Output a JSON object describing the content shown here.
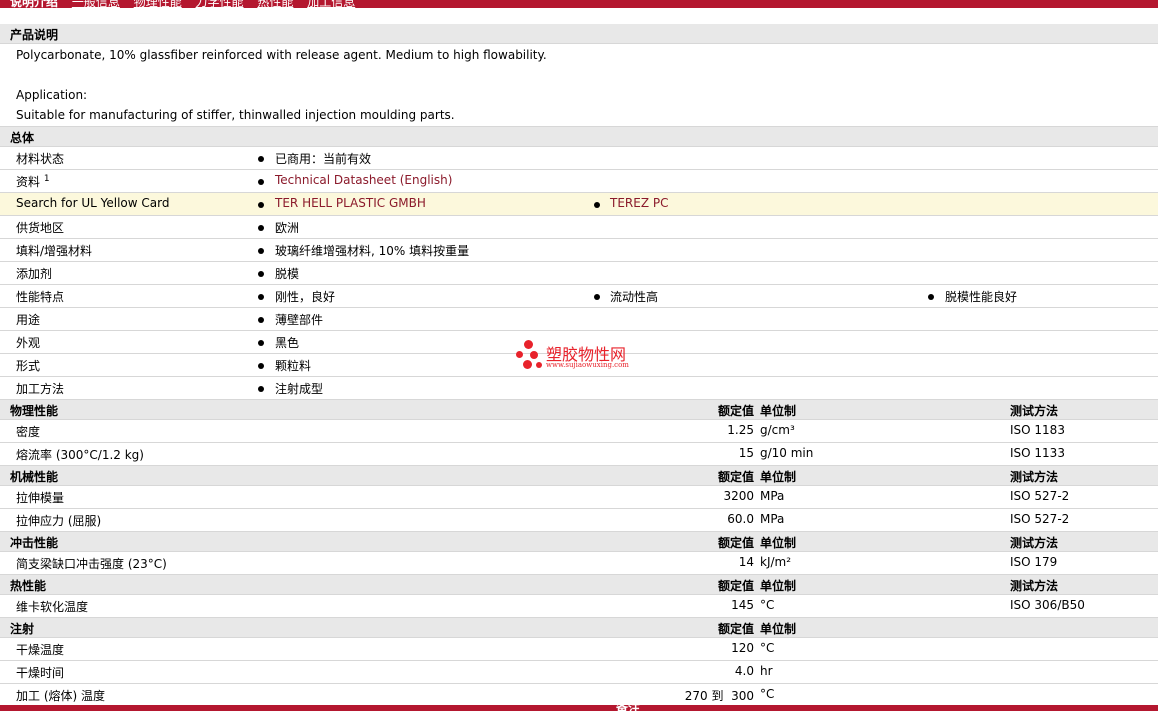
{
  "topbar": {
    "tabs": [
      "说明介绍",
      "一般信息",
      "物理性能",
      "力学性能",
      "热性能",
      "加工信息"
    ]
  },
  "description": {
    "title": "产品说明",
    "line1": "Polycarbonate, 10% glassfiber reinforced with release agent. Medium to high flowability.",
    "line2": "Application:",
    "line3": "Suitable for manufacturing of stiffer, thinwalled injection moulding parts."
  },
  "general": {
    "title": "总体",
    "rows": [
      {
        "label": "材料状态",
        "values": [
          "已商用：当前有效"
        ]
      },
      {
        "label": "资料",
        "sup": "1",
        "values": [
          "Technical Datasheet (English)"
        ]
      },
      {
        "label": "Search for UL Yellow Card",
        "values": [
          "TER HELL PLASTIC GMBH",
          "TEREZ PC"
        ]
      },
      {
        "label": "供货地区",
        "values": [
          "欧洲"
        ]
      },
      {
        "label": "填料/增强材料",
        "values": [
          "玻璃纤维增强材料, 10% 填料按重量"
        ]
      },
      {
        "label": "添加剂",
        "values": [
          "脱模"
        ]
      },
      {
        "label": "性能特点",
        "values": [
          "刚性，良好",
          "流动性高",
          "脱模性能良好"
        ]
      },
      {
        "label": "用途",
        "values": [
          "薄壁部件"
        ]
      },
      {
        "label": "外观",
        "values": [
          "黑色"
        ]
      },
      {
        "label": "形式",
        "values": [
          "颗粒料"
        ]
      },
      {
        "label": "加工方法",
        "values": [
          "注射成型"
        ]
      }
    ]
  },
  "headers": {
    "value": "额定值",
    "unit": "单位制",
    "method": "测试方法"
  },
  "physical": {
    "title": "物理性能",
    "rows": [
      {
        "label": "密度",
        "value": "1.25",
        "unit": "g/cm³",
        "method": "ISO 1183"
      },
      {
        "label": "熔流率 (300°C/1.2 kg)",
        "value": "15",
        "unit": "g/10 min",
        "method": "ISO 1133"
      }
    ]
  },
  "mechanical": {
    "title": "机械性能",
    "rows": [
      {
        "label": "拉伸模量",
        "value": "3200",
        "unit": "MPa",
        "method": "ISO 527-2"
      },
      {
        "label": "拉伸应力 (屈服)",
        "value": "60.0",
        "unit": "MPa",
        "method": "ISO 527-2"
      }
    ]
  },
  "impact": {
    "title": "冲击性能",
    "rows": [
      {
        "label": "简支梁缺口冲击强度 (23°C)",
        "value": "14",
        "unit": "kJ/m²",
        "method": "ISO 179"
      }
    ]
  },
  "thermal": {
    "title": "热性能",
    "rows": [
      {
        "label": "维卡软化温度",
        "value": "145",
        "unit": "°C",
        "method": "ISO 306/B50"
      }
    ]
  },
  "injection": {
    "title": "注射",
    "rows": [
      {
        "label": "干燥温度",
        "value": "120",
        "unit": "°C"
      },
      {
        "label": "干燥时间",
        "value": "4.0",
        "unit": "hr"
      },
      {
        "label": "加工 (熔体) 温度",
        "value": "270 到  300",
        "unit": "°C"
      }
    ]
  },
  "watermark": {
    "cn": "塑胶物性网",
    "en": "www.sujiaowuxing.com"
  },
  "bottombar": {
    "label": "备注"
  }
}
